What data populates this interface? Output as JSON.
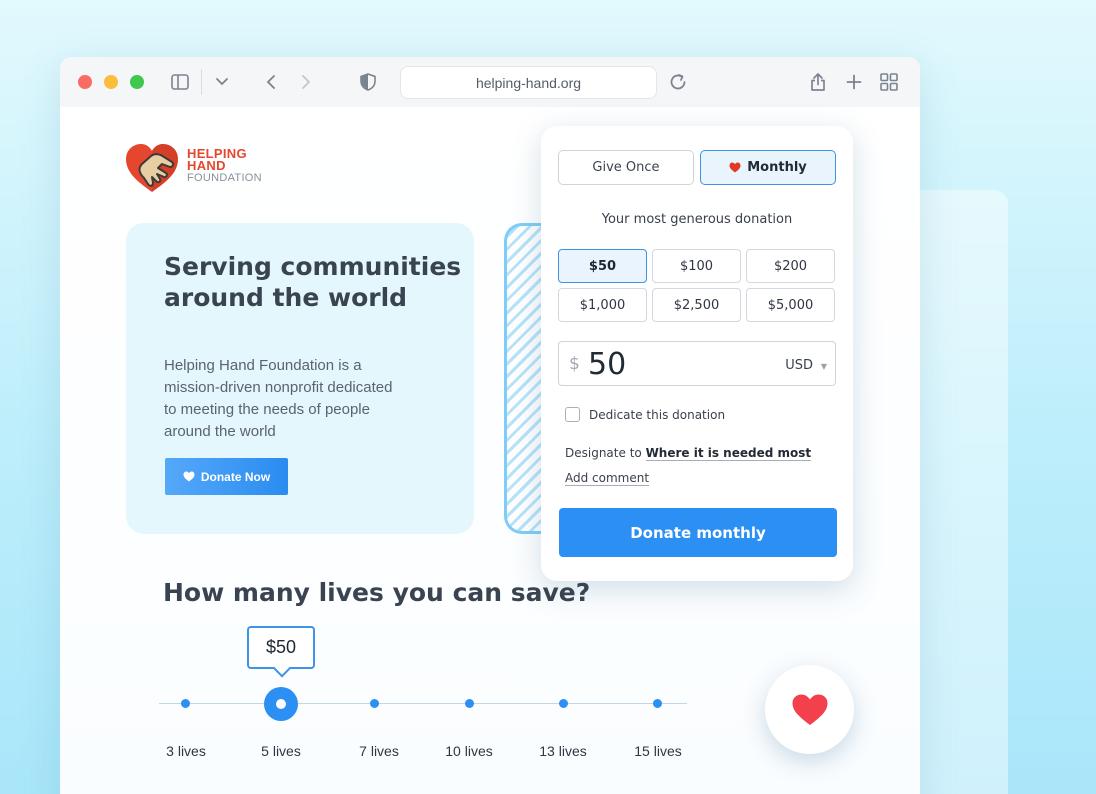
{
  "browser": {
    "url": "helping-hand.org"
  },
  "logo": {
    "line1": "HELPING",
    "line2": "HAND",
    "line3": "FOUNDATION"
  },
  "hero": {
    "title": "Serving communities around the world",
    "description": "Helping Hand Foundation is a mission-driven nonprofit dedicated to meeting the needs of people around the world",
    "button_label": "Donate Now"
  },
  "donation_form": {
    "tabs": [
      {
        "label": "Give Once",
        "selected": false
      },
      {
        "label": "Monthly",
        "selected": true
      }
    ],
    "subtitle": "Your most generous donation",
    "amounts": [
      {
        "label": "$50",
        "selected": true
      },
      {
        "label": "$100",
        "selected": false
      },
      {
        "label": "$200",
        "selected": false
      },
      {
        "label": "$1,000",
        "selected": false
      },
      {
        "label": "$2,500",
        "selected": false
      },
      {
        "label": "$5,000",
        "selected": false
      }
    ],
    "currency_symbol": "$",
    "amount_value": "50",
    "currency_code": "USD",
    "dedicate_label": "Dedicate this donation",
    "dedicate_checked": false,
    "designate_prefix": "Designate to",
    "designate_value": "Where it is needed most",
    "add_comment_label": "Add comment",
    "submit_label": "Donate monthly"
  },
  "lives": {
    "title": "How many lives you can save?",
    "tooltip": "$50",
    "selected_index": 1,
    "steps": [
      "3 lives",
      "5 lives",
      "7 lives",
      "10 lives",
      "13 lives",
      "15 lives"
    ]
  },
  "colors": {
    "accent": "#2b8ff3",
    "brand_red": "#e5472e",
    "heart": "#f2404c"
  }
}
